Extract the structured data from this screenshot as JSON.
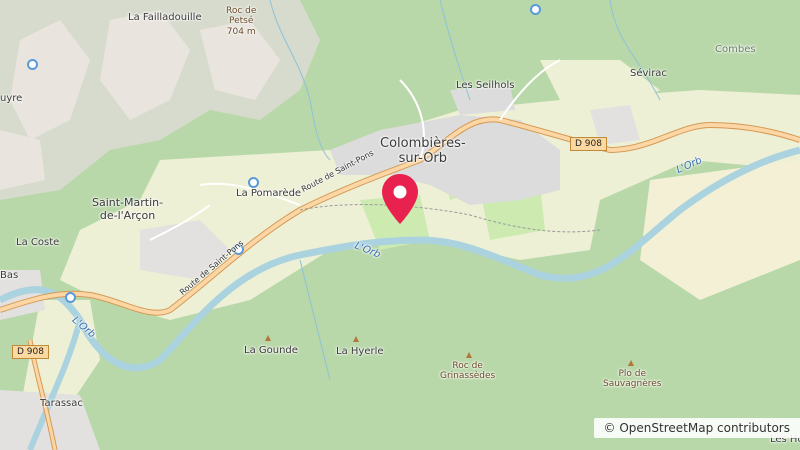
{
  "map": {
    "labels": {
      "la_failladouille": "La Failladouille",
      "roc_de_petse": "Roc de\nPetsé\n704 m",
      "les_seilhols": "Les Seilhols",
      "sevirac": "Sévirac",
      "combes": "Combes",
      "colombieres": "Colombières-\nsur-Orb",
      "la_pomarede": "La Pomarède",
      "saint_martin": "Saint-Martin-\nde-l'Arçon",
      "la_coste": "La Coste",
      "bas": "Bas",
      "uyre": "uyre",
      "la_gounde": "La Gounde",
      "la_hyerle": "La Hyerle",
      "roc_de_grinassedes": "Roc de\nGrinassèdes",
      "plo_de_sauvagneres": "Plo de\nSauvagnères",
      "tarassac": "Tarassac",
      "les_ho": "Les Ho"
    },
    "road_labels": {
      "route_saint_pons_1": "Route de Saint-Pons",
      "route_saint_pons_2": "Route de Saint-Pons"
    },
    "river_labels": {
      "lorb_center": "L'Orb",
      "lorb_left": "L'Orb",
      "lorb_right": "L'Orb"
    },
    "shields": {
      "d908_top": "D 908",
      "d908_left": "D 908"
    },
    "attribution": "© OpenStreetMap contributors",
    "colors": {
      "forest": "#b9d8a9",
      "grass": "#cdebb0",
      "farmland": "#eef0d5",
      "residential": "#e0dfdf",
      "water": "#aad3df",
      "river_line": "#8ec2d8",
      "road_primary": "#fcd6a4",
      "road_casing": "#d49a56",
      "rock": "#e8e3dc",
      "marker": "#e8214f"
    },
    "marker_icon": "map-pin-icon"
  }
}
